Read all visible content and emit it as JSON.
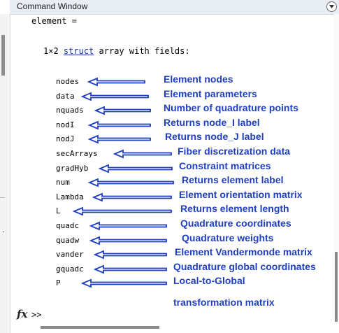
{
  "window": {
    "title": "Command Window"
  },
  "output": {
    "echo": "element =",
    "summary_prefix": "1×2",
    "summary_link": "struct",
    "summary_suffix": "array with fields:"
  },
  "fields": [
    {
      "name": "nodes",
      "desc": "Element nodes"
    },
    {
      "name": "data",
      "desc": "Element parameters"
    },
    {
      "name": "nquads",
      "desc": "Number of quadrature points"
    },
    {
      "name": "nodI",
      "desc": "Returns node_I label"
    },
    {
      "name": "nodJ",
      "desc": "Returns node_J label"
    },
    {
      "name": "secArrays",
      "desc": "Fiber discretization data"
    },
    {
      "name": "gradHyb",
      "desc": "Constraint matrices"
    },
    {
      "name": "num",
      "desc": "Returns element label"
    },
    {
      "name": "Lambda",
      "desc": "Element orientation matrix"
    },
    {
      "name": "L",
      "desc": "Returns element length"
    },
    {
      "name": "quadc",
      "desc": "Quadrature coordinates"
    },
    {
      "name": "quadw",
      "desc": "Quadrature weights"
    },
    {
      "name": "vander",
      "desc": "Element Vandermonde matrix"
    },
    {
      "name": "gquadc",
      "desc": "Quadrature global coordinates"
    },
    {
      "name": "P",
      "desc": "Local-to-Global"
    }
  ],
  "extra_line": "transformation matrix",
  "prompt": {
    "fx": "fx",
    "symbol": ">>"
  },
  "icons": {
    "menu": "chevron-down-icon",
    "prompt": "function-icon",
    "annotation": "arrow-left-icon"
  },
  "colors": {
    "annotation": "#1f3fbf",
    "link": "#1a3a9c"
  }
}
